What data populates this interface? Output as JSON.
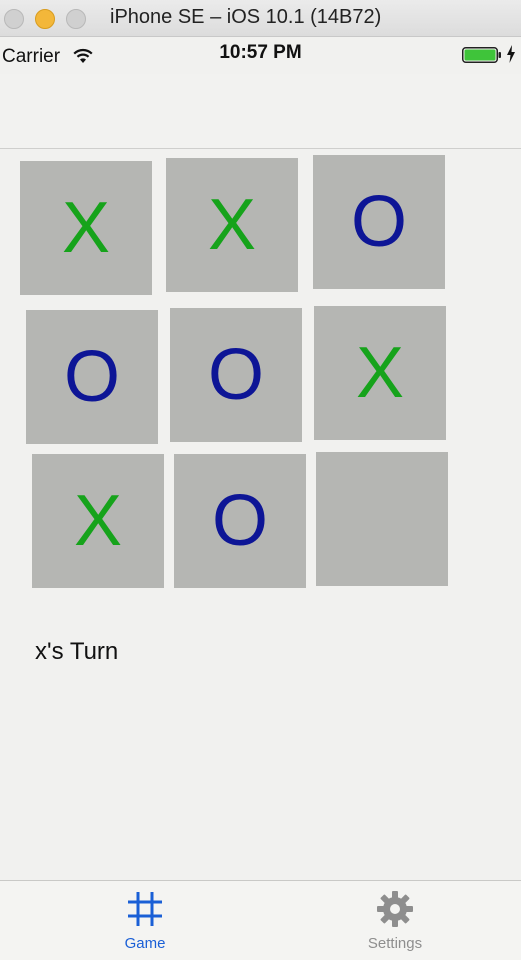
{
  "window": {
    "title": "iPhone SE – iOS 10.1 (14B72)"
  },
  "status_bar": {
    "carrier": "Carrier",
    "time": "10:57 PM",
    "battery_color": "#3fc43a"
  },
  "board": {
    "cells": [
      {
        "mark": "X",
        "kind": "x"
      },
      {
        "mark": "X",
        "kind": "x"
      },
      {
        "mark": "O",
        "kind": "o"
      },
      {
        "mark": "O",
        "kind": "o"
      },
      {
        "mark": "O",
        "kind": "o"
      },
      {
        "mark": "X",
        "kind": "x"
      },
      {
        "mark": "X",
        "kind": "x"
      },
      {
        "mark": "O",
        "kind": "o"
      },
      {
        "mark": "",
        "kind": "empty"
      }
    ],
    "x_color": "#16a31b",
    "o_color": "#0d1596",
    "cell_color": "#b5b6b3"
  },
  "game": {
    "turn_text": "x's Turn"
  },
  "tab_bar": {
    "tabs": [
      {
        "label": "Game",
        "icon": "grid-icon",
        "selected": true
      },
      {
        "label": "Settings",
        "icon": "gear-icon",
        "selected": false
      }
    ],
    "active_color": "#1a5fd6",
    "inactive_color": "#8e8e8e"
  }
}
